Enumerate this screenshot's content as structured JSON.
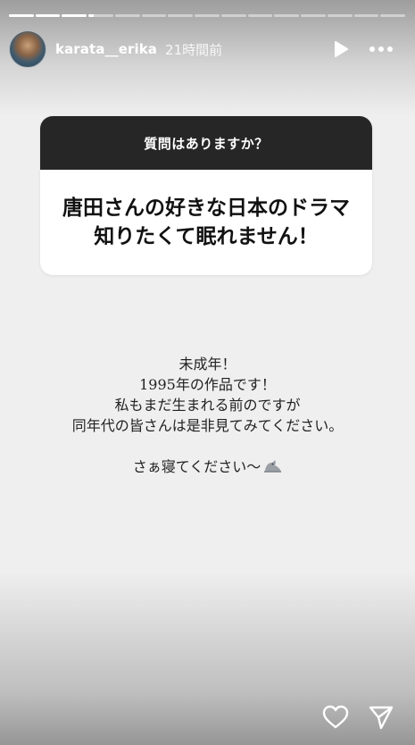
{
  "story": {
    "segments_total": 15,
    "segments_completed": 3,
    "current_segment_progress": 0.2
  },
  "header": {
    "username": "karata__erika",
    "time_ago": "21時間前",
    "play_icon": "play-icon",
    "more_icon": "more-icon"
  },
  "question_card": {
    "prompt": "質問はありますか？",
    "question_lines": [
      "唐田さんの好きな日本のドラマ",
      "知りたくて眠れません！"
    ],
    "header_color": "#262626"
  },
  "reply": {
    "lines": [
      "未成年！",
      "1995年の作品です！",
      "私もまだ生まれる前のですが",
      "同年代の皆さんは是非見てみてください。"
    ],
    "closing": "さぁ寝てください〜",
    "closing_icon": "seal-icon"
  },
  "footer": {
    "like_icon": "heart-icon",
    "share_icon": "send-icon"
  }
}
